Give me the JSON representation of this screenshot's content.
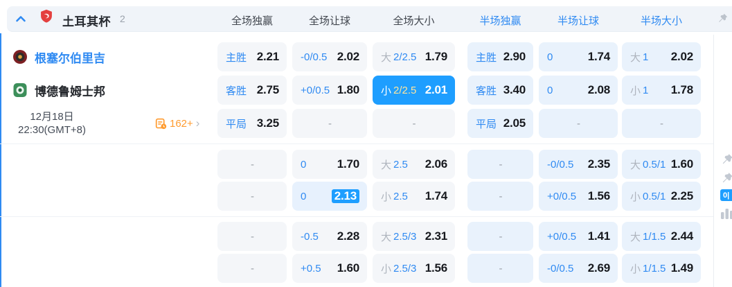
{
  "league_header": {
    "league_name": "土耳其杯",
    "match_count": "2",
    "columns": [
      {
        "label": "全场独赢"
      },
      {
        "label": "全场让球"
      },
      {
        "label": "全场大小"
      },
      {
        "label": "半场独赢"
      },
      {
        "label": "半场让球"
      },
      {
        "label": "半场大小"
      }
    ]
  },
  "match": {
    "home_team": "根塞尔伯里吉",
    "away_team": "博德鲁姆士邦",
    "date": "12月18日",
    "time": "22:30(GMT+8)",
    "more_markets": "162+"
  },
  "side_tools": {
    "odds_format_badge": "0|"
  },
  "icons": {
    "collapse": "chevron-up-icon",
    "league_logo": "red-shield-logo",
    "more_markets": "document-clock-icon",
    "expand": "chevron-right-icon",
    "pin": "pushpin-icon",
    "stats": "bar-chart-icon"
  },
  "colors": {
    "accent_blue": "#2f8af2",
    "selected_bg": "#1e9eff",
    "selected_line": "#ffe59d",
    "orange": "#ff9b2f",
    "ft_cell_bg": "#f4f6f9",
    "ht_cell_bg": "#e9f2fc"
  },
  "grid": {
    "sections": [
      {
        "rows": [
          {
            "cells": [
              {
                "type": "label",
                "label": "主胜",
                "value": "2.21"
              },
              {
                "type": "line",
                "line": "-0/0.5",
                "value": "2.02"
              },
              {
                "type": "ou",
                "prefix": "大",
                "line": "2/2.5",
                "value": "1.79"
              },
              {
                "type": "label",
                "label": "主胜",
                "value": "2.90"
              },
              {
                "type": "line",
                "line": "0",
                "value": "1.74"
              },
              {
                "type": "ou",
                "prefix": "大",
                "line": "1",
                "value": "2.02"
              }
            ]
          },
          {
            "cells": [
              {
                "type": "label",
                "label": "客胜",
                "value": "2.75"
              },
              {
                "type": "line",
                "line": "+0/0.5",
                "value": "1.80"
              },
              {
                "type": "ou",
                "prefix": "小",
                "line": "2/2.5",
                "value": "2.01",
                "selected": true
              },
              {
                "type": "label",
                "label": "客胜",
                "value": "3.40"
              },
              {
                "type": "line",
                "line": "0",
                "value": "2.08"
              },
              {
                "type": "ou",
                "prefix": "小",
                "line": "1",
                "value": "1.78"
              }
            ]
          },
          {
            "cells": [
              {
                "type": "label",
                "label": "平局",
                "value": "3.25"
              },
              {
                "type": "dash"
              },
              {
                "type": "dash"
              },
              {
                "type": "label",
                "label": "平局",
                "value": "2.05"
              },
              {
                "type": "dash"
              },
              {
                "type": "dash"
              }
            ]
          }
        ]
      },
      {
        "rows": [
          {
            "cells": [
              {
                "type": "dash"
              },
              {
                "type": "line",
                "line": "0",
                "value": "1.70"
              },
              {
                "type": "ou",
                "prefix": "大",
                "line": "2.5",
                "value": "2.06"
              },
              {
                "type": "dash"
              },
              {
                "type": "line",
                "line": "-0/0.5",
                "value": "2.35"
              },
              {
                "type": "ou",
                "prefix": "大",
                "line": "0.5/1",
                "value": "1.60"
              }
            ]
          },
          {
            "cells": [
              {
                "type": "dash"
              },
              {
                "type": "line",
                "line": "0",
                "value": "2.13",
                "flash": true
              },
              {
                "type": "ou",
                "prefix": "小",
                "line": "2.5",
                "value": "1.74"
              },
              {
                "type": "dash"
              },
              {
                "type": "line",
                "line": "+0/0.5",
                "value": "1.56"
              },
              {
                "type": "ou",
                "prefix": "小",
                "line": "0.5/1",
                "value": "2.25"
              }
            ]
          }
        ]
      },
      {
        "rows": [
          {
            "cells": [
              {
                "type": "dash"
              },
              {
                "type": "line",
                "line": "-0.5",
                "value": "2.28"
              },
              {
                "type": "ou",
                "prefix": "大",
                "line": "2.5/3",
                "value": "2.31"
              },
              {
                "type": "dash"
              },
              {
                "type": "line",
                "line": "+0/0.5",
                "value": "1.41"
              },
              {
                "type": "ou",
                "prefix": "大",
                "line": "1/1.5",
                "value": "2.44"
              }
            ]
          },
          {
            "cells": [
              {
                "type": "dash"
              },
              {
                "type": "line",
                "line": "+0.5",
                "value": "1.60"
              },
              {
                "type": "ou",
                "prefix": "小",
                "line": "2.5/3",
                "value": "1.56"
              },
              {
                "type": "dash"
              },
              {
                "type": "line",
                "line": "-0/0.5",
                "value": "2.69"
              },
              {
                "type": "ou",
                "prefix": "小",
                "line": "1/1.5",
                "value": "1.49"
              }
            ]
          }
        ]
      }
    ]
  }
}
